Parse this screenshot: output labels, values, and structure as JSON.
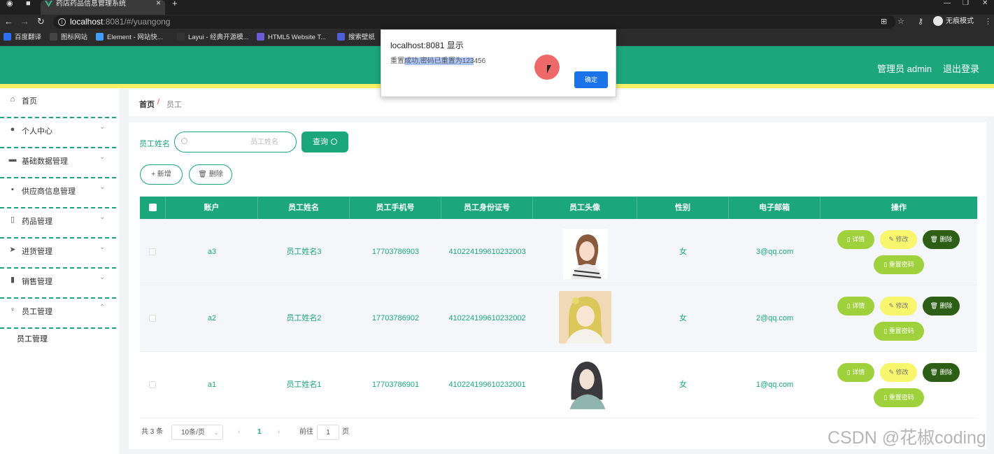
{
  "browser": {
    "tab_title": "药店药品信息管理系统",
    "url_host": "localhost",
    "url_rest": ":8081/#/yuangong",
    "incognito_label": "无痕模式",
    "bookmarks": [
      {
        "label": "百度翻译",
        "color": "#2d6ff0"
      },
      {
        "label": "图标网站",
        "color": "#444444"
      },
      {
        "label": "Element - 网站快...",
        "color": "#409eff"
      },
      {
        "label": "Layui - 经典开源模...",
        "color": "#333333"
      },
      {
        "label": "HTML5 Website T...",
        "color": "#6b5bd6"
      },
      {
        "label": "搜索壁纸",
        "color": "#4c5fd5"
      }
    ]
  },
  "header": {
    "user_label": "管理员 admin",
    "logout_label": "退出登录"
  },
  "sidebar": {
    "items": [
      {
        "label": "首页",
        "icon": "home-icon",
        "glyph": "⌂",
        "has_arrow": false
      },
      {
        "label": "个人中心",
        "icon": "user-icon",
        "glyph": "●",
        "has_arrow": true
      },
      {
        "label": "基础数据管理",
        "icon": "ticket-icon",
        "glyph": "▬",
        "has_arrow": true
      },
      {
        "label": "供应商信息管理",
        "icon": "monitor-icon",
        "glyph": "▪",
        "has_arrow": true
      },
      {
        "label": "药品管理",
        "icon": "phone-icon",
        "glyph": "▯",
        "has_arrow": true
      },
      {
        "label": "进货管理",
        "icon": "send-icon",
        "glyph": "➤",
        "has_arrow": true
      },
      {
        "label": "销售管理",
        "icon": "chart-icon",
        "glyph": "▮",
        "has_arrow": true
      },
      {
        "label": "员工管理",
        "icon": "mic-icon",
        "glyph": "♀",
        "has_arrow": true
      }
    ],
    "sub_item": "员工管理"
  },
  "breadcrumb": {
    "home": "首页",
    "separator": "/",
    "current": "员工"
  },
  "search": {
    "label": "员工姓名",
    "placeholder": "员工姓名",
    "query_label": "查询"
  },
  "toolbar": {
    "add_label": "+ 新增",
    "delete_label": "🗑 删除"
  },
  "table": {
    "columns": [
      "账户",
      "员工姓名",
      "员工手机号",
      "员工身份证号",
      "员工头像",
      "性别",
      "电子邮箱",
      "操作"
    ],
    "rows": [
      {
        "account": "a3",
        "name": "员工姓名3",
        "phone": "17703786903",
        "idcard": "410224199610232003",
        "gender": "女",
        "email": "3@qq.com"
      },
      {
        "account": "a2",
        "name": "员工姓名2",
        "phone": "17703786902",
        "idcard": "410224199610232002",
        "gender": "女",
        "email": "2@qq.com"
      },
      {
        "account": "a1",
        "name": "员工姓名1",
        "phone": "17703786901",
        "idcard": "410224199610232001",
        "gender": "女",
        "email": "1@qq.com"
      }
    ],
    "actions": {
      "detail": "详情",
      "edit": "修改",
      "delete": "删除",
      "reset": "重置密码"
    }
  },
  "pagination": {
    "total": "共 3 条",
    "page_size": "10条/页",
    "current_page": "1",
    "goto_prefix": "前往",
    "goto_value": "1",
    "goto_suffix": "页"
  },
  "dialog": {
    "title": "localhost:8081 显示",
    "message_pre": "重置",
    "message_sel": "成功,密码已重置为123",
    "message_post": "456",
    "ok_label": "确定"
  },
  "watermark": "CSDN @花椒coding",
  "colors": {
    "primary": "#1ba779",
    "accent_yellow": "#f5f066",
    "btn_green_light": "#9fd13c",
    "btn_yellow": "#f8f66c",
    "btn_dark_green": "#2d5e16",
    "dialog_ok": "#1a73e8"
  }
}
